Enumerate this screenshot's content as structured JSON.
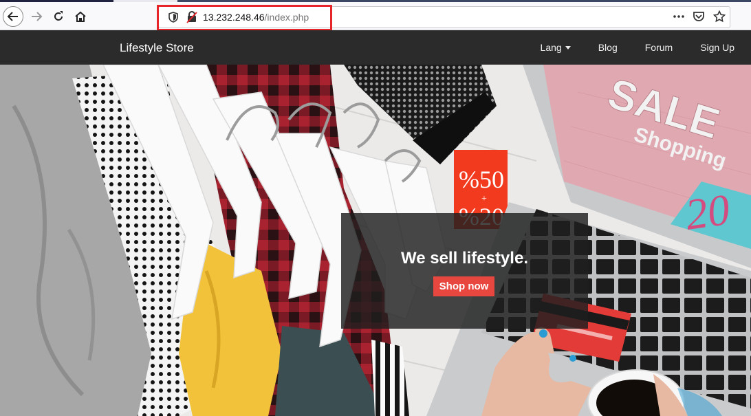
{
  "browser": {
    "url_host": "13.232.248.46",
    "url_path": "/index.php"
  },
  "site": {
    "brand": "Lifestyle Store",
    "nav": {
      "lang": "Lang",
      "blog": "Blog",
      "forum": "Forum",
      "signup": "Sign Up"
    }
  },
  "hero": {
    "headline": "We sell lifestyle.",
    "cta": "Shop now",
    "laptop_sale": "SALE",
    "laptop_shopping": "Shopping",
    "laptop_number": "20",
    "tag_top": "%50",
    "tag_plus": "+",
    "tag_bottom": "%20"
  }
}
